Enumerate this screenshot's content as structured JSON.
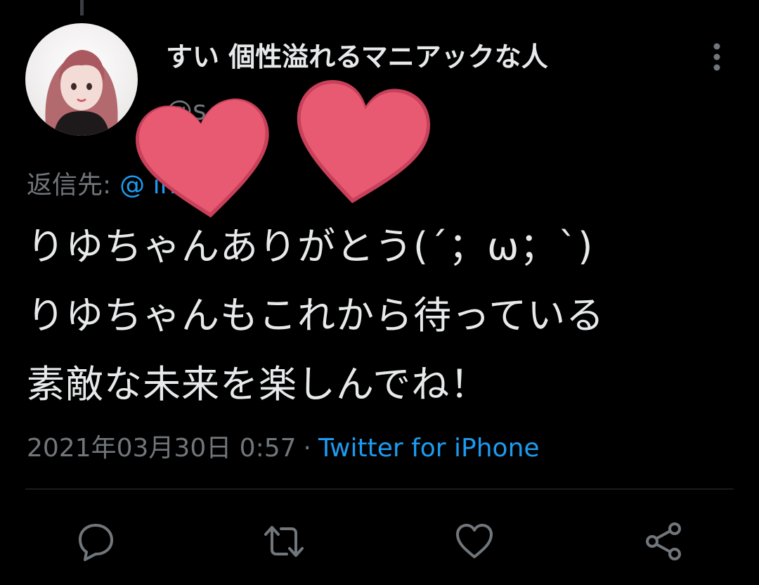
{
  "tweet": {
    "display_name": "すい 個性溢れるマニアックな人",
    "username": "@s",
    "reply": {
      "label": "返信先:",
      "mention": "@                ino さ"
    },
    "text_lines": [
      "りゆちゃんありがとう(´；ω；`)",
      "りゆちゃんもこれから待っている",
      "素敵な未来を楽しんでね！"
    ],
    "timestamp": "2021年03月30日 0:57",
    "separator": "·",
    "source": "Twitter for iPhone"
  },
  "icons": {
    "more": "more-vertical-icon",
    "reply": "reply-icon",
    "retweet": "retweet-icon",
    "like": "heart-icon",
    "share": "share-icon",
    "sticker": "heart-sticker"
  },
  "colors": {
    "background": "#000000",
    "text": "#e7e9ea",
    "muted": "#71767b",
    "link": "#1d9bf0",
    "sticker": "#e85a71"
  }
}
